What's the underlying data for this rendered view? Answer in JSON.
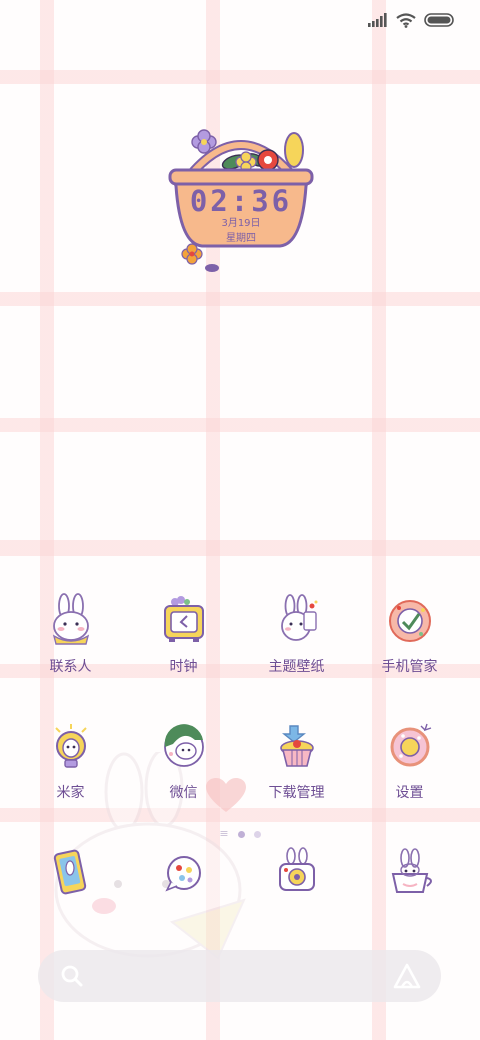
{
  "status_bar": {
    "icons": [
      "signal-icon",
      "wifi-icon",
      "battery-icon"
    ]
  },
  "clock_widget": {
    "time": "02:36",
    "date": "3月19日",
    "weekday": "星期四"
  },
  "apps": [
    {
      "label": "联系人",
      "icon": "contacts-icon"
    },
    {
      "label": "时钟",
      "icon": "clock-icon"
    },
    {
      "label": "主题壁纸",
      "icon": "themes-icon"
    },
    {
      "label": "手机管家",
      "icon": "security-icon"
    },
    {
      "label": "米家",
      "icon": "mijia-icon"
    },
    {
      "label": "微信",
      "icon": "wechat-icon"
    },
    {
      "label": "下载管理",
      "icon": "downloads-icon"
    },
    {
      "label": "设置",
      "icon": "settings-icon"
    }
  ],
  "dock": [
    {
      "icon": "phone-icon"
    },
    {
      "icon": "messages-icon"
    },
    {
      "icon": "camera-icon"
    },
    {
      "icon": "browser-icon"
    }
  ],
  "page_indicator": {
    "pages": 2,
    "active": 0
  },
  "search_bar": {
    "left_icon": "search-icon",
    "right_icon": "assistant-icon"
  },
  "colors": {
    "accent_purple": "#7d60a8",
    "basket_peach": "#f7b98c",
    "grid_pink": "#fcd6d6"
  }
}
